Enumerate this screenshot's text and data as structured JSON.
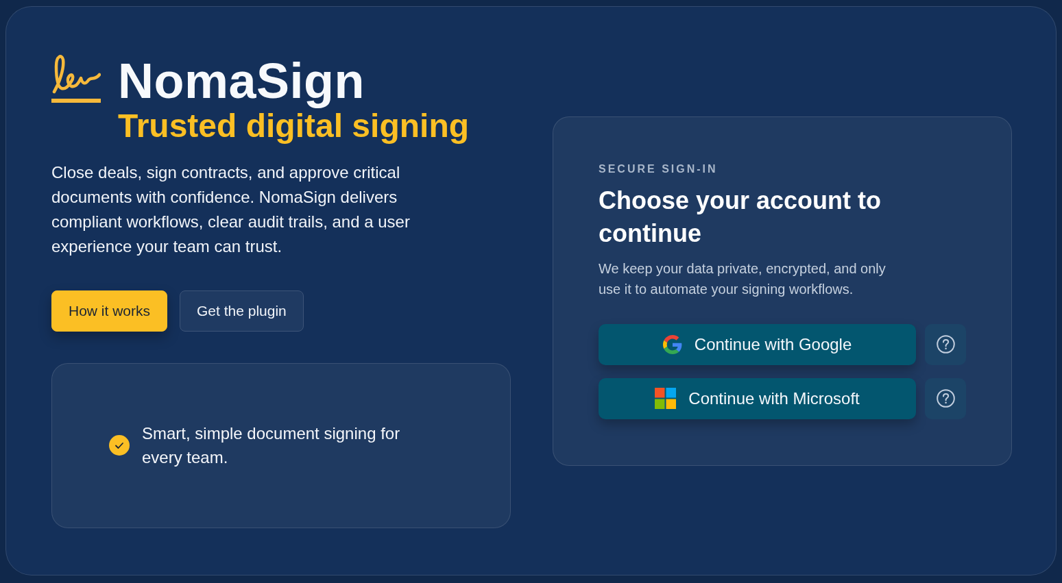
{
  "brand": {
    "name": "NomaSign",
    "tagline": "Trusted digital signing"
  },
  "hero": {
    "description": "Close deals, sign contracts, and approve critical documents with confidence. NomaSign delivers compliant workflows, clear audit trails, and a user experience your team can trust.",
    "actions": [
      {
        "label": "How it works",
        "kind": "primary"
      },
      {
        "label": "Get the plugin",
        "kind": "secondary"
      }
    ]
  },
  "feature": {
    "text": "Smart, simple document signing for every team."
  },
  "signin": {
    "eyebrow": "SECURE SIGN-IN",
    "heading": "Choose your account to continue",
    "description": "We keep your data private, encrypted, and only use it to automate your signing workflows.",
    "providers": [
      {
        "label": "Continue with Google",
        "kind": "google"
      },
      {
        "label": "Continue with Microsoft",
        "kind": "microsoft"
      }
    ]
  }
}
